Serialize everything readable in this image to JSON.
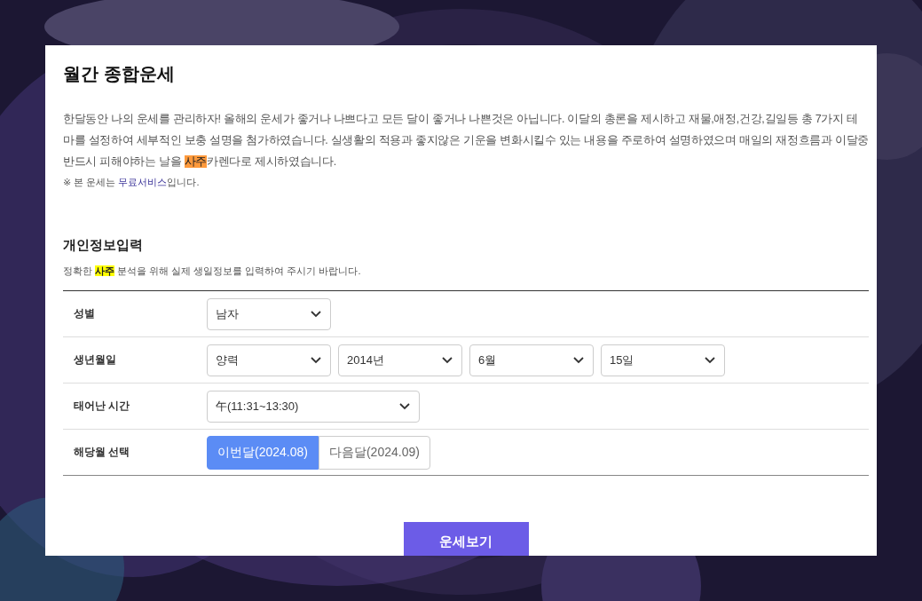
{
  "title": "월간 종합운세",
  "intro": {
    "before": "한달동안 나의 운세를 관리하자! 올해의 운세가 좋거나 나쁘다고 모든 달이 좋거나 나쁜것은 아닙니다. 이달의 총론을 제시하고 재물,애정,건강,길일등 총 7가지 테마를 설정하여 세부적인 보충 설명을 첨가하였습니다. 실생활의 적용과 좋지않은 기운을 변화시킬수 있는 내용을 주로하여 설명하였으며 매일의 재정흐름과 이달중 반드시 피해야하는 날을 ",
    "highlight": "사주",
    "after": "카렌다로 제시하였습니다."
  },
  "notice": {
    "before": "※ 본 운세는 ",
    "link": "무료서비스",
    "after": "입니다."
  },
  "section": {
    "title": "개인정보입력",
    "hint": {
      "before": "정확한 ",
      "highlight": "사주",
      "after": " 분석을 위해 실제 생일정보를 입력하여 주시기 바랍니다."
    }
  },
  "rows": [
    {
      "label": "성별",
      "kind": "select",
      "fields": [
        {
          "value": "남자",
          "wide": false
        }
      ]
    },
    {
      "label": "생년월일",
      "kind": "select",
      "fields": [
        {
          "value": "양력",
          "wide": false
        },
        {
          "value": "2014년",
          "wide": false
        },
        {
          "value": "6월",
          "wide": false
        },
        {
          "value": "15일",
          "wide": false
        }
      ]
    },
    {
      "label": "태어난 시간",
      "kind": "select",
      "fields": [
        {
          "value": "午(11:31~13:30)",
          "wide": true
        }
      ]
    },
    {
      "label": "해당월 선택",
      "kind": "toggle",
      "options": [
        {
          "label": "이번달(2024.08)",
          "selected": true
        },
        {
          "label": "다음달(2024.09)",
          "selected": false
        }
      ]
    }
  ],
  "submit": "운세보기"
}
